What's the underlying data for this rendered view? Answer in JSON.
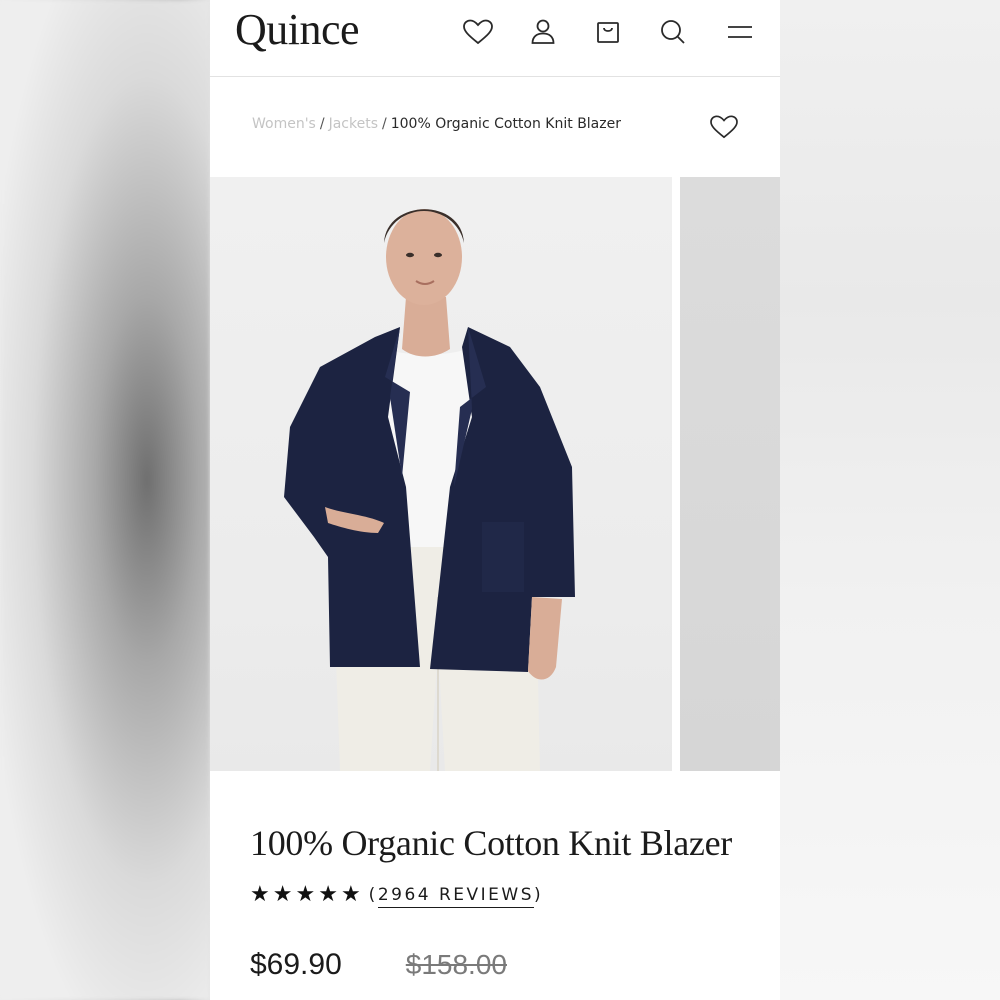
{
  "brand": {
    "logo": "Quince"
  },
  "header": {
    "icons": [
      "heart-icon",
      "user-icon",
      "bag-icon",
      "search-icon",
      "menu-icon"
    ]
  },
  "breadcrumb": {
    "items": [
      "Women's",
      "Jackets",
      "100% Organic Cotton Knit Blazer"
    ],
    "separator": "/"
  },
  "product": {
    "title": "100% Organic Cotton Knit Blazer",
    "rating": {
      "stars": 5,
      "star_glyph": "★"
    },
    "reviews_label": "2964 REVIEWS",
    "reviews_open": "(",
    "reviews_close": ")",
    "price": "$69.90",
    "original_price": "$158.00",
    "garment_color": "#1c2341"
  },
  "colors": {
    "text": "#1b1b1b",
    "faded_breadcrumb": "#c4c4c4",
    "background": "#ffffff"
  }
}
